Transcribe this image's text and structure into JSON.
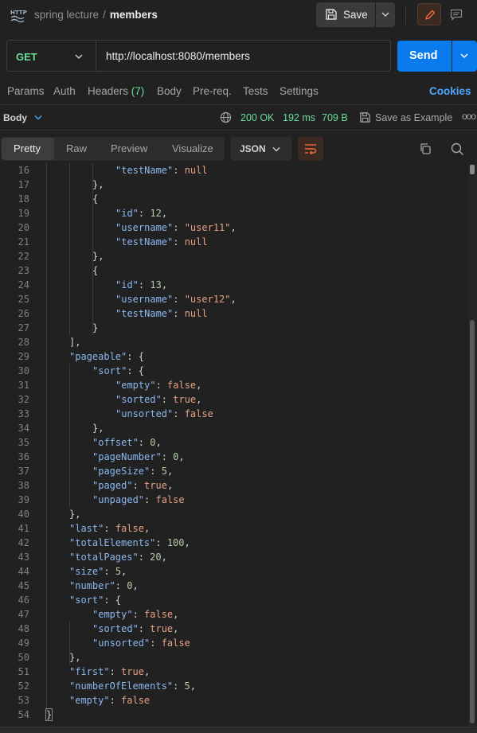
{
  "header": {
    "collection": "spring lecture",
    "separator": "/",
    "request_name": "members",
    "save_label": "Save"
  },
  "request": {
    "method": "GET",
    "url": "http://localhost:8080/members",
    "send_label": "Send"
  },
  "tabs": {
    "params": "Params",
    "auth": "Auth",
    "headers": "Headers",
    "headers_count": "(7)",
    "body": "Body",
    "prereq": "Pre-req.",
    "tests": "Tests",
    "settings": "Settings",
    "cookies": "Cookies"
  },
  "response": {
    "body_label": "Body",
    "status": "200 OK",
    "time": "192 ms",
    "size": "709 B",
    "save_example": "Save as Example",
    "more": "ooo"
  },
  "view": {
    "tabs": [
      "Pretty",
      "Raw",
      "Preview",
      "Visualize"
    ],
    "active": "Pretty",
    "format": "JSON"
  },
  "code_lines": [
    {
      "n": "16",
      "indent": 4,
      "tokens": [
        [
          "k",
          "\"testName\""
        ],
        [
          "p",
          ": "
        ],
        [
          "l",
          "null"
        ]
      ]
    },
    {
      "n": "17",
      "indent": 3,
      "tokens": [
        [
          "p",
          "},"
        ]
      ]
    },
    {
      "n": "18",
      "indent": 3,
      "tokens": [
        [
          "p",
          "{"
        ]
      ]
    },
    {
      "n": "19",
      "indent": 4,
      "tokens": [
        [
          "k",
          "\"id\""
        ],
        [
          "p",
          ": "
        ],
        [
          "n",
          "12"
        ],
        [
          "p",
          ","
        ]
      ]
    },
    {
      "n": "20",
      "indent": 4,
      "tokens": [
        [
          "k",
          "\"username\""
        ],
        [
          "p",
          ": "
        ],
        [
          "s",
          "\"user11\""
        ],
        [
          "p",
          ","
        ]
      ]
    },
    {
      "n": "21",
      "indent": 4,
      "tokens": [
        [
          "k",
          "\"testName\""
        ],
        [
          "p",
          ": "
        ],
        [
          "l",
          "null"
        ]
      ]
    },
    {
      "n": "22",
      "indent": 3,
      "tokens": [
        [
          "p",
          "},"
        ]
      ]
    },
    {
      "n": "23",
      "indent": 3,
      "tokens": [
        [
          "p",
          "{"
        ]
      ]
    },
    {
      "n": "24",
      "indent": 4,
      "tokens": [
        [
          "k",
          "\"id\""
        ],
        [
          "p",
          ": "
        ],
        [
          "n",
          "13"
        ],
        [
          "p",
          ","
        ]
      ]
    },
    {
      "n": "25",
      "indent": 4,
      "tokens": [
        [
          "k",
          "\"username\""
        ],
        [
          "p",
          ": "
        ],
        [
          "s",
          "\"user12\""
        ],
        [
          "p",
          ","
        ]
      ]
    },
    {
      "n": "26",
      "indent": 4,
      "tokens": [
        [
          "k",
          "\"testName\""
        ],
        [
          "p",
          ": "
        ],
        [
          "l",
          "null"
        ]
      ]
    },
    {
      "n": "27",
      "indent": 3,
      "tokens": [
        [
          "p",
          "}"
        ]
      ]
    },
    {
      "n": "28",
      "indent": 2,
      "tokens": [
        [
          "p",
          "],"
        ]
      ]
    },
    {
      "n": "29",
      "indent": 2,
      "tokens": [
        [
          "k",
          "\"pageable\""
        ],
        [
          "p",
          ": {"
        ]
      ]
    },
    {
      "n": "30",
      "indent": 3,
      "tokens": [
        [
          "k",
          "\"sort\""
        ],
        [
          "p",
          ": {"
        ]
      ]
    },
    {
      "n": "31",
      "indent": 4,
      "tokens": [
        [
          "k",
          "\"empty\""
        ],
        [
          "p",
          ": "
        ],
        [
          "l",
          "false"
        ],
        [
          "p",
          ","
        ]
      ]
    },
    {
      "n": "32",
      "indent": 4,
      "tokens": [
        [
          "k",
          "\"sorted\""
        ],
        [
          "p",
          ": "
        ],
        [
          "l",
          "true"
        ],
        [
          "p",
          ","
        ]
      ]
    },
    {
      "n": "33",
      "indent": 4,
      "tokens": [
        [
          "k",
          "\"unsorted\""
        ],
        [
          "p",
          ": "
        ],
        [
          "l",
          "false"
        ]
      ]
    },
    {
      "n": "34",
      "indent": 3,
      "tokens": [
        [
          "p",
          "},"
        ]
      ]
    },
    {
      "n": "35",
      "indent": 3,
      "tokens": [
        [
          "k",
          "\"offset\""
        ],
        [
          "p",
          ": "
        ],
        [
          "n",
          "0"
        ],
        [
          "p",
          ","
        ]
      ]
    },
    {
      "n": "36",
      "indent": 3,
      "tokens": [
        [
          "k",
          "\"pageNumber\""
        ],
        [
          "p",
          ": "
        ],
        [
          "n",
          "0"
        ],
        [
          "p",
          ","
        ]
      ]
    },
    {
      "n": "37",
      "indent": 3,
      "tokens": [
        [
          "k",
          "\"pageSize\""
        ],
        [
          "p",
          ": "
        ],
        [
          "n",
          "5"
        ],
        [
          "p",
          ","
        ]
      ]
    },
    {
      "n": "38",
      "indent": 3,
      "tokens": [
        [
          "k",
          "\"paged\""
        ],
        [
          "p",
          ": "
        ],
        [
          "l",
          "true"
        ],
        [
          "p",
          ","
        ]
      ]
    },
    {
      "n": "39",
      "indent": 3,
      "tokens": [
        [
          "k",
          "\"unpaged\""
        ],
        [
          "p",
          ": "
        ],
        [
          "l",
          "false"
        ]
      ]
    },
    {
      "n": "40",
      "indent": 2,
      "tokens": [
        [
          "p",
          "},"
        ]
      ]
    },
    {
      "n": "41",
      "indent": 2,
      "tokens": [
        [
          "k",
          "\"last\""
        ],
        [
          "p",
          ": "
        ],
        [
          "l",
          "false"
        ],
        [
          "p",
          ","
        ]
      ]
    },
    {
      "n": "42",
      "indent": 2,
      "tokens": [
        [
          "k",
          "\"totalElements\""
        ],
        [
          "p",
          ": "
        ],
        [
          "n",
          "100"
        ],
        [
          "p",
          ","
        ]
      ]
    },
    {
      "n": "43",
      "indent": 2,
      "tokens": [
        [
          "k",
          "\"totalPages\""
        ],
        [
          "p",
          ": "
        ],
        [
          "n",
          "20"
        ],
        [
          "p",
          ","
        ]
      ]
    },
    {
      "n": "44",
      "indent": 2,
      "tokens": [
        [
          "k",
          "\"size\""
        ],
        [
          "p",
          ": "
        ],
        [
          "n",
          "5"
        ],
        [
          "p",
          ","
        ]
      ]
    },
    {
      "n": "45",
      "indent": 2,
      "tokens": [
        [
          "k",
          "\"number\""
        ],
        [
          "p",
          ": "
        ],
        [
          "n",
          "0"
        ],
        [
          "p",
          ","
        ]
      ]
    },
    {
      "n": "46",
      "indent": 2,
      "tokens": [
        [
          "k",
          "\"sort\""
        ],
        [
          "p",
          ": {"
        ]
      ]
    },
    {
      "n": "47",
      "indent": 3,
      "tokens": [
        [
          "k",
          "\"empty\""
        ],
        [
          "p",
          ": "
        ],
        [
          "l",
          "false"
        ],
        [
          "p",
          ","
        ]
      ]
    },
    {
      "n": "48",
      "indent": 3,
      "tokens": [
        [
          "k",
          "\"sorted\""
        ],
        [
          "p",
          ": "
        ],
        [
          "l",
          "true"
        ],
        [
          "p",
          ","
        ]
      ]
    },
    {
      "n": "49",
      "indent": 3,
      "tokens": [
        [
          "k",
          "\"unsorted\""
        ],
        [
          "p",
          ": "
        ],
        [
          "l",
          "false"
        ]
      ]
    },
    {
      "n": "50",
      "indent": 2,
      "tokens": [
        [
          "p",
          "},"
        ]
      ]
    },
    {
      "n": "51",
      "indent": 2,
      "tokens": [
        [
          "k",
          "\"first\""
        ],
        [
          "p",
          ": "
        ],
        [
          "l",
          "true"
        ],
        [
          "p",
          ","
        ]
      ]
    },
    {
      "n": "52",
      "indent": 2,
      "tokens": [
        [
          "k",
          "\"numberOfElements\""
        ],
        [
          "p",
          ": "
        ],
        [
          "n",
          "5"
        ],
        [
          "p",
          ","
        ]
      ]
    },
    {
      "n": "53",
      "indent": 2,
      "tokens": [
        [
          "k",
          "\"empty\""
        ],
        [
          "p",
          ": "
        ],
        [
          "l",
          "false"
        ]
      ]
    },
    {
      "n": "54",
      "indent": 1,
      "tokens": [
        [
          "p",
          "}"
        ]
      ]
    }
  ]
}
